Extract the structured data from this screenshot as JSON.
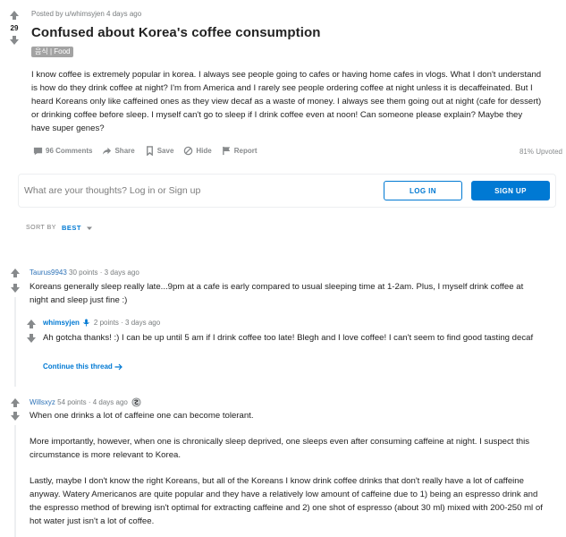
{
  "post": {
    "score": "29",
    "byline": "Posted by u/whimsyjen 4 days ago",
    "title": "Confused about Korea's coffee consumption",
    "flair": "음식 | Food",
    "body": "I know coffee is extremely popular in korea. I always see people going to cafes or having home cafes in vlogs. What I don't understand is how do they drink coffee at night? I'm from America and I rarely see people ordering coffee at night unless it is decaffeinated. But I heard Koreans only like caffeined ones as they view decaf as a waste of money. I always see them going out at night (cafe for dessert) or drinking coffee before sleep. I myself can't go to sleep if I drink coffee even at noon! Can someone please explain? Maybe they have super genes?",
    "actions": {
      "comments": "96 Comments",
      "share": "Share",
      "save": "Save",
      "hide": "Hide",
      "report": "Report"
    },
    "upvoted": "81% Upvoted"
  },
  "comment_box": {
    "prompt": "What are your thoughts? Log in or Sign up",
    "login_label": "LOG IN",
    "signup_label": "SIGN UP"
  },
  "sort": {
    "label": "SORT BY",
    "value": "BEST"
  },
  "comments": [
    {
      "author": "Taurus9943",
      "points": "30 points",
      "time": "3 days ago",
      "text": "Koreans generally sleep really late...9pm at a cafe is early compared to usual sleeping time at 1-2am. Plus, I myself drink coffee at night and sleep just fine :)"
    },
    {
      "author": "whimsyjen",
      "points": "2 points",
      "time": "3 days ago",
      "text": "Ah gotcha thanks! :) I can be up until 5 am if I drink coffee too late! Blegh and I love coffee! I can't seem to find good tasting decaf",
      "continue_label": "Continue this thread"
    },
    {
      "author": "Willsxyz",
      "points": "54 points",
      "time": "4 days ago",
      "paragraphs": [
        "When one drinks a lot of caffeine one can become tolerant.",
        "More importantly, however, when one is chronically sleep deprived, one sleeps even after consuming caffeine at night. I suspect this circumstance is more relevant to Korea.",
        "Lastly, maybe I don't know the right Koreans, but all of the Koreans I know drink coffee drinks that don't really have a lot of caffeine anyway. Watery Americanos are quite popular and they have a relatively low amount of caffeine due to 1) being an espresso drink and the espresso method of brewing isn't optimal for extracting caffeine and 2) one shot of espresso (about 30 ml) mixed with 200-250 ml of hot water just isn't a lot of coffee."
      ]
    }
  ],
  "colors": {
    "accent": "#0079d3",
    "muted": "#878a8c",
    "text": "#222222"
  }
}
